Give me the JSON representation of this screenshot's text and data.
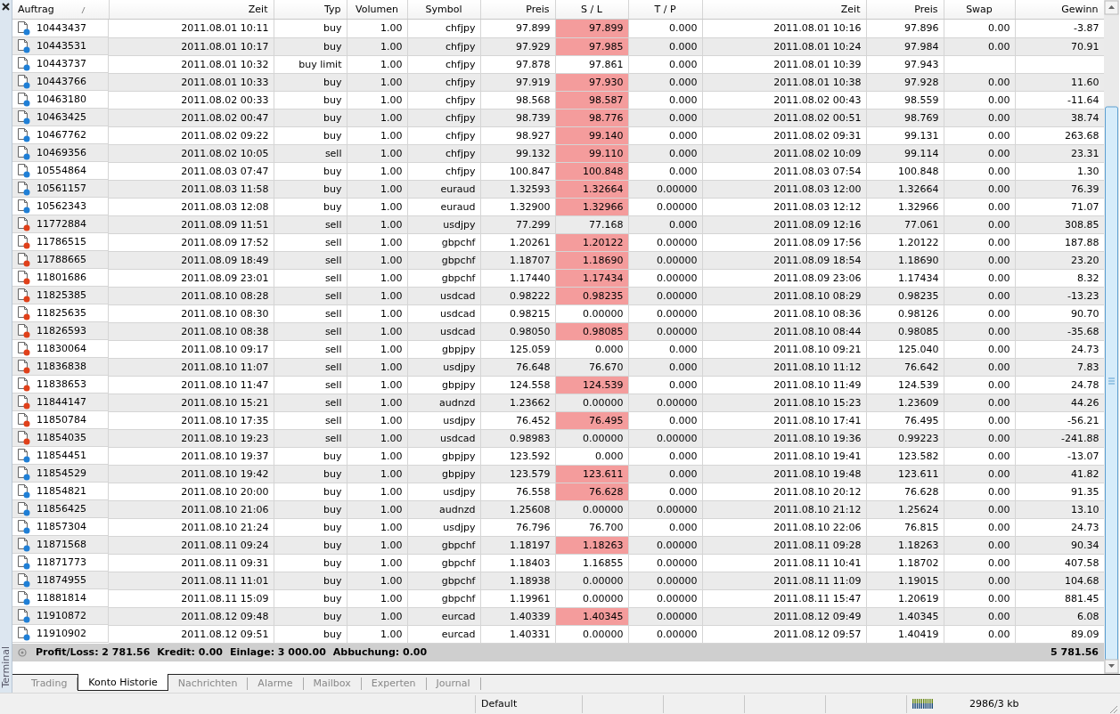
{
  "terminal": {
    "side_label": "Terminal"
  },
  "table": {
    "columns": [
      "Auftrag",
      "Zeit",
      "Typ",
      "Volumen",
      "Symbol",
      "Preis",
      "S / L",
      "T / P",
      "Zeit",
      "Preis",
      "Swap",
      "Gewinn"
    ],
    "rows": [
      {
        "order": "10443437",
        "open_time": "2011.08.01 10:11",
        "type": "buy",
        "volume": "1.00",
        "symbol": "chfjpy",
        "price": "97.899",
        "sl": "97.899",
        "sl_hit": true,
        "tp": "0.000",
        "close_time": "2011.08.01 10:16",
        "close_price": "97.896",
        "swap": "0.00",
        "profit": "-3.87",
        "color": "#1f7fd6"
      },
      {
        "order": "10443531",
        "open_time": "2011.08.01 10:17",
        "type": "buy",
        "volume": "1.00",
        "symbol": "chfjpy",
        "price": "97.929",
        "sl": "97.985",
        "sl_hit": true,
        "tp": "0.000",
        "close_time": "2011.08.01 10:24",
        "close_price": "97.984",
        "swap": "0.00",
        "profit": "70.91",
        "color": "#1f7fd6"
      },
      {
        "order": "10443737",
        "open_time": "2011.08.01 10:32",
        "type": "buy limit",
        "volume": "1.00",
        "symbol": "chfjpy",
        "price": "97.878",
        "sl": "97.861",
        "sl_hit": false,
        "tp": "0.000",
        "close_time": "2011.08.01 10:39",
        "close_price": "97.943",
        "color": "#1f7fd6"
      },
      {
        "order": "10443766",
        "open_time": "2011.08.01 10:33",
        "type": "buy",
        "volume": "1.00",
        "symbol": "chfjpy",
        "price": "97.919",
        "sl": "97.930",
        "sl_hit": true,
        "tp": "0.000",
        "close_time": "2011.08.01 10:38",
        "close_price": "97.928",
        "swap": "0.00",
        "profit": "11.60",
        "color": "#1f7fd6"
      },
      {
        "order": "10463180",
        "open_time": "2011.08.02 00:33",
        "type": "buy",
        "volume": "1.00",
        "symbol": "chfjpy",
        "price": "98.568",
        "sl": "98.587",
        "sl_hit": true,
        "tp": "0.000",
        "close_time": "2011.08.02 00:43",
        "close_price": "98.559",
        "swap": "0.00",
        "profit": "-11.64",
        "color": "#1f7fd6"
      },
      {
        "order": "10463425",
        "open_time": "2011.08.02 00:47",
        "type": "buy",
        "volume": "1.00",
        "symbol": "chfjpy",
        "price": "98.739",
        "sl": "98.776",
        "sl_hit": true,
        "tp": "0.000",
        "close_time": "2011.08.02 00:51",
        "close_price": "98.769",
        "swap": "0.00",
        "profit": "38.74",
        "color": "#1f7fd6"
      },
      {
        "order": "10467762",
        "open_time": "2011.08.02 09:22",
        "type": "buy",
        "volume": "1.00",
        "symbol": "chfjpy",
        "price": "98.927",
        "sl": "99.140",
        "sl_hit": true,
        "tp": "0.000",
        "close_time": "2011.08.02 09:31",
        "close_price": "99.131",
        "swap": "0.00",
        "profit": "263.68",
        "color": "#1f7fd6"
      },
      {
        "order": "10469356",
        "open_time": "2011.08.02 10:05",
        "type": "sell",
        "volume": "1.00",
        "symbol": "chfjpy",
        "price": "99.132",
        "sl": "99.110",
        "sl_hit": true,
        "tp": "0.000",
        "close_time": "2011.08.02 10:09",
        "close_price": "99.114",
        "swap": "0.00",
        "profit": "23.31",
        "color": "#1f7fd6"
      },
      {
        "order": "10554864",
        "open_time": "2011.08.03 07:47",
        "type": "buy",
        "volume": "1.00",
        "symbol": "chfjpy",
        "price": "100.847",
        "sl": "100.848",
        "sl_hit": true,
        "tp": "0.000",
        "close_time": "2011.08.03 07:54",
        "close_price": "100.848",
        "swap": "0.00",
        "profit": "1.30",
        "color": "#1f7fd6"
      },
      {
        "order": "10561157",
        "open_time": "2011.08.03 11:58",
        "type": "buy",
        "volume": "1.00",
        "symbol": "euraud",
        "price": "1.32593",
        "sl": "1.32664",
        "sl_hit": true,
        "tp": "0.00000",
        "close_time": "2011.08.03 12:00",
        "close_price": "1.32664",
        "swap": "0.00",
        "profit": "76.39",
        "color": "#1f7fd6"
      },
      {
        "order": "10562343",
        "open_time": "2011.08.03 12:08",
        "type": "buy",
        "volume": "1.00",
        "symbol": "euraud",
        "price": "1.32900",
        "sl": "1.32966",
        "sl_hit": true,
        "tp": "0.00000",
        "close_time": "2011.08.03 12:12",
        "close_price": "1.32966",
        "swap": "0.00",
        "profit": "71.07",
        "color": "#1f7fd6"
      },
      {
        "order": "11772884",
        "open_time": "2011.08.09 11:51",
        "type": "sell",
        "volume": "1.00",
        "symbol": "usdjpy",
        "price": "77.299",
        "sl": "77.168",
        "sl_hit": false,
        "tp": "0.000",
        "close_time": "2011.08.09 12:16",
        "close_price": "77.061",
        "swap": "0.00",
        "profit": "308.85",
        "color": "#e0401a"
      },
      {
        "order": "11786515",
        "open_time": "2011.08.09 17:52",
        "type": "sell",
        "volume": "1.00",
        "symbol": "gbpchf",
        "price": "1.20261",
        "sl": "1.20122",
        "sl_hit": true,
        "tp": "0.00000",
        "close_time": "2011.08.09 17:56",
        "close_price": "1.20122",
        "swap": "0.00",
        "profit": "187.88",
        "color": "#e0401a"
      },
      {
        "order": "11788665",
        "open_time": "2011.08.09 18:49",
        "type": "sell",
        "volume": "1.00",
        "symbol": "gbpchf",
        "price": "1.18707",
        "sl": "1.18690",
        "sl_hit": true,
        "tp": "0.00000",
        "close_time": "2011.08.09 18:54",
        "close_price": "1.18690",
        "swap": "0.00",
        "profit": "23.20",
        "color": "#e0401a"
      },
      {
        "order": "11801686",
        "open_time": "2011.08.09 23:01",
        "type": "sell",
        "volume": "1.00",
        "symbol": "gbpchf",
        "price": "1.17440",
        "sl": "1.17434",
        "sl_hit": true,
        "tp": "0.00000",
        "close_time": "2011.08.09 23:06",
        "close_price": "1.17434",
        "swap": "0.00",
        "profit": "8.32",
        "color": "#e0401a"
      },
      {
        "order": "11825385",
        "open_time": "2011.08.10 08:28",
        "type": "sell",
        "volume": "1.00",
        "symbol": "usdcad",
        "price": "0.98222",
        "sl": "0.98235",
        "sl_hit": true,
        "tp": "0.00000",
        "close_time": "2011.08.10 08:29",
        "close_price": "0.98235",
        "swap": "0.00",
        "profit": "-13.23",
        "color": "#e0401a"
      },
      {
        "order": "11825635",
        "open_time": "2011.08.10 08:30",
        "type": "sell",
        "volume": "1.00",
        "symbol": "usdcad",
        "price": "0.98215",
        "sl": "0.00000",
        "sl_hit": false,
        "tp": "0.00000",
        "close_time": "2011.08.10 08:36",
        "close_price": "0.98126",
        "swap": "0.00",
        "profit": "90.70",
        "color": "#e0401a"
      },
      {
        "order": "11826593",
        "open_time": "2011.08.10 08:38",
        "type": "sell",
        "volume": "1.00",
        "symbol": "usdcad",
        "price": "0.98050",
        "sl": "0.98085",
        "sl_hit": true,
        "tp": "0.00000",
        "close_time": "2011.08.10 08:44",
        "close_price": "0.98085",
        "swap": "0.00",
        "profit": "-35.68",
        "color": "#e0401a"
      },
      {
        "order": "11830064",
        "open_time": "2011.08.10 09:17",
        "type": "sell",
        "volume": "1.00",
        "symbol": "gbpjpy",
        "price": "125.059",
        "sl": "0.000",
        "sl_hit": false,
        "tp": "0.000",
        "close_time": "2011.08.10 09:21",
        "close_price": "125.040",
        "swap": "0.00",
        "profit": "24.73",
        "color": "#e0401a"
      },
      {
        "order": "11836838",
        "open_time": "2011.08.10 11:07",
        "type": "sell",
        "volume": "1.00",
        "symbol": "usdjpy",
        "price": "76.648",
        "sl": "76.670",
        "sl_hit": false,
        "tp": "0.000",
        "close_time": "2011.08.10 11:12",
        "close_price": "76.642",
        "swap": "0.00",
        "profit": "7.83",
        "color": "#e0401a"
      },
      {
        "order": "11838653",
        "open_time": "2011.08.10 11:47",
        "type": "sell",
        "volume": "1.00",
        "symbol": "gbpjpy",
        "price": "124.558",
        "sl": "124.539",
        "sl_hit": true,
        "tp": "0.000",
        "close_time": "2011.08.10 11:49",
        "close_price": "124.539",
        "swap": "0.00",
        "profit": "24.78",
        "color": "#e0401a"
      },
      {
        "order": "11844147",
        "open_time": "2011.08.10 15:21",
        "type": "sell",
        "volume": "1.00",
        "symbol": "audnzd",
        "price": "1.23662",
        "sl": "0.00000",
        "sl_hit": false,
        "tp": "0.00000",
        "close_time": "2011.08.10 15:23",
        "close_price": "1.23609",
        "swap": "0.00",
        "profit": "44.26",
        "color": "#e0401a"
      },
      {
        "order": "11850784",
        "open_time": "2011.08.10 17:35",
        "type": "sell",
        "volume": "1.00",
        "symbol": "usdjpy",
        "price": "76.452",
        "sl": "76.495",
        "sl_hit": true,
        "tp": "0.000",
        "close_time": "2011.08.10 17:41",
        "close_price": "76.495",
        "swap": "0.00",
        "profit": "-56.21",
        "color": "#e0401a"
      },
      {
        "order": "11854035",
        "open_time": "2011.08.10 19:23",
        "type": "sell",
        "volume": "1.00",
        "symbol": "usdcad",
        "price": "0.98983",
        "sl": "0.00000",
        "sl_hit": false,
        "tp": "0.00000",
        "close_time": "2011.08.10 19:36",
        "close_price": "0.99223",
        "swap": "0.00",
        "profit": "-241.88",
        "color": "#e0401a"
      },
      {
        "order": "11854451",
        "open_time": "2011.08.10 19:37",
        "type": "buy",
        "volume": "1.00",
        "symbol": "gbpjpy",
        "price": "123.592",
        "sl": "0.000",
        "sl_hit": false,
        "tp": "0.000",
        "close_time": "2011.08.10 19:41",
        "close_price": "123.582",
        "swap": "0.00",
        "profit": "-13.07",
        "color": "#1f7fd6"
      },
      {
        "order": "11854529",
        "open_time": "2011.08.10 19:42",
        "type": "buy",
        "volume": "1.00",
        "symbol": "gbpjpy",
        "price": "123.579",
        "sl": "123.611",
        "sl_hit": true,
        "tp": "0.000",
        "close_time": "2011.08.10 19:48",
        "close_price": "123.611",
        "swap": "0.00",
        "profit": "41.82",
        "color": "#1f7fd6"
      },
      {
        "order": "11854821",
        "open_time": "2011.08.10 20:00",
        "type": "buy",
        "volume": "1.00",
        "symbol": "usdjpy",
        "price": "76.558",
        "sl": "76.628",
        "sl_hit": true,
        "tp": "0.000",
        "close_time": "2011.08.10 20:12",
        "close_price": "76.628",
        "swap": "0.00",
        "profit": "91.35",
        "color": "#1f7fd6"
      },
      {
        "order": "11856425",
        "open_time": "2011.08.10 21:06",
        "type": "buy",
        "volume": "1.00",
        "symbol": "audnzd",
        "price": "1.25608",
        "sl": "0.00000",
        "sl_hit": false,
        "tp": "0.00000",
        "close_time": "2011.08.10 21:12",
        "close_price": "1.25624",
        "swap": "0.00",
        "profit": "13.10",
        "color": "#1f7fd6"
      },
      {
        "order": "11857304",
        "open_time": "2011.08.10 21:24",
        "type": "buy",
        "volume": "1.00",
        "symbol": "usdjpy",
        "price": "76.796",
        "sl": "76.700",
        "sl_hit": false,
        "tp": "0.000",
        "close_time": "2011.08.10 22:06",
        "close_price": "76.815",
        "swap": "0.00",
        "profit": "24.73",
        "color": "#1f7fd6"
      },
      {
        "order": "11871568",
        "open_time": "2011.08.11 09:24",
        "type": "buy",
        "volume": "1.00",
        "symbol": "gbpchf",
        "price": "1.18197",
        "sl": "1.18263",
        "sl_hit": true,
        "tp": "0.00000",
        "close_time": "2011.08.11 09:28",
        "close_price": "1.18263",
        "swap": "0.00",
        "profit": "90.34",
        "color": "#1f7fd6"
      },
      {
        "order": "11871773",
        "open_time": "2011.08.11 09:31",
        "type": "buy",
        "volume": "1.00",
        "symbol": "gbpchf",
        "price": "1.18403",
        "sl": "1.16855",
        "sl_hit": false,
        "tp": "0.00000",
        "close_time": "2011.08.11 10:41",
        "close_price": "1.18702",
        "swap": "0.00",
        "profit": "407.58",
        "color": "#1f7fd6"
      },
      {
        "order": "11874955",
        "open_time": "2011.08.11 11:01",
        "type": "buy",
        "volume": "1.00",
        "symbol": "gbpchf",
        "price": "1.18938",
        "sl": "0.00000",
        "sl_hit": false,
        "tp": "0.00000",
        "close_time": "2011.08.11 11:09",
        "close_price": "1.19015",
        "swap": "0.00",
        "profit": "104.68",
        "color": "#1f7fd6"
      },
      {
        "order": "11881814",
        "open_time": "2011.08.11 15:09",
        "type": "buy",
        "volume": "1.00",
        "symbol": "gbpchf",
        "price": "1.19961",
        "sl": "0.00000",
        "sl_hit": false,
        "tp": "0.00000",
        "close_time": "2011.08.11 15:47",
        "close_price": "1.20619",
        "swap": "0.00",
        "profit": "881.45",
        "color": "#1f7fd6"
      },
      {
        "order": "11910872",
        "open_time": "2011.08.12 09:48",
        "type": "buy",
        "volume": "1.00",
        "symbol": "eurcad",
        "price": "1.40339",
        "sl": "1.40345",
        "sl_hit": true,
        "tp": "0.00000",
        "close_time": "2011.08.12 09:49",
        "close_price": "1.40345",
        "swap": "0.00",
        "profit": "6.08",
        "color": "#1f7fd6"
      },
      {
        "order": "11910902",
        "open_time": "2011.08.12 09:51",
        "type": "buy",
        "volume": "1.00",
        "symbol": "eurcad",
        "price": "1.40331",
        "sl": "0.00000",
        "sl_hit": false,
        "tp": "0.00000",
        "close_time": "2011.08.12 09:57",
        "close_price": "1.40419",
        "swap": "0.00",
        "profit": "89.09",
        "color": "#1f7fd6"
      }
    ],
    "summary": {
      "items": [
        "Profit/Loss: 2 781.56",
        "Kredit: 0.00",
        "Einlage: 3 000.00",
        "Abbuchung: 0.00"
      ],
      "total": "5 781.56"
    }
  },
  "tabs": [
    {
      "label": "Trading",
      "selected": false
    },
    {
      "label": "Konto Historie",
      "selected": true
    },
    {
      "label": "Nachrichten",
      "selected": false
    },
    {
      "label": "Alarme",
      "selected": false
    },
    {
      "label": "Mailbox",
      "selected": false
    },
    {
      "label": "Experten",
      "selected": false
    },
    {
      "label": "Journal",
      "selected": false
    }
  ],
  "status_bar": {
    "profile": "Default",
    "memory": "2986/3 kb"
  }
}
